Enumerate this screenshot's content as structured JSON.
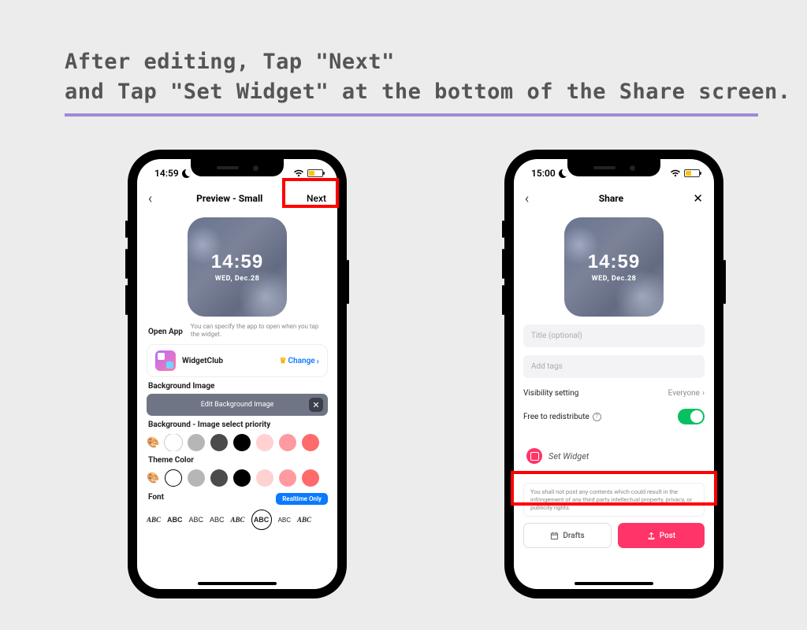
{
  "heading_line1": "After editing, Tap \"Next\"",
  "heading_line2": "and Tap \"Set Widget\" at the bottom of the Share screen.",
  "phone1": {
    "status_time": "14:59",
    "nav_title": "Preview - Small",
    "nav_next": "Next",
    "widget_time": "14:59",
    "widget_date": "WED, Dec.28",
    "open_app_label": "Open App",
    "open_app_subtext": "You can specify the app to open when you tap the widget.",
    "app_name": "WidgetClub",
    "change_label": "Change",
    "bg_image_label": "Background Image",
    "edit_bg_label": "Edit Background Image",
    "bg_priority_label": "Background - Image select priority",
    "theme_color_label": "Theme Color",
    "font_label": "Font",
    "realtime_badge": "Realtime Only",
    "font_items": [
      "ABC",
      "ABC",
      "ABC",
      "ABC",
      "ABC",
      "ABC",
      "ABC",
      "ABC"
    ],
    "swatches1": [
      "#ffffff",
      "#b6b6b6",
      "#4b4b4b",
      "#000000",
      "#ffd1d1",
      "#ff9aa0",
      "#ff6a6a"
    ],
    "swatches2": [
      "#ffffff",
      "#b6b6b6",
      "#4b4b4b",
      "#000000",
      "#ffd1d1",
      "#ff9aa0",
      "#ff6a6a"
    ]
  },
  "phone2": {
    "status_time": "15:00",
    "nav_title": "Share",
    "widget_time": "14:59",
    "widget_date": "WED, Dec.28",
    "title_placeholder": "Title (optional)",
    "tags_placeholder": "Add tags",
    "visibility_label": "Visibility setting",
    "visibility_value": "Everyone",
    "redistribute_label": "Free to redistribute",
    "set_widget_label": "Set Widget",
    "disclaimer": "You shall not post any contents which could result in the infringement of any third party intellectual property, privacy, or publicity rights.",
    "drafts_label": "Drafts",
    "post_label": "Post"
  }
}
